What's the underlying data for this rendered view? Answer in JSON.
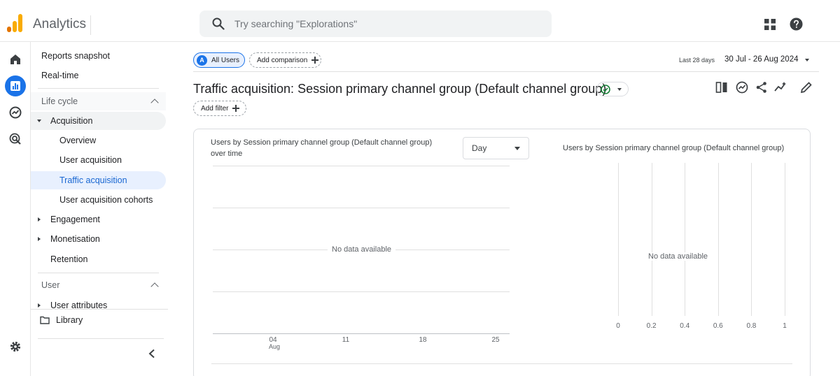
{
  "app": {
    "title": "Analytics"
  },
  "search": {
    "placeholder": "Try searching \"Explorations\""
  },
  "sidebar": {
    "items": [
      {
        "label": "Reports snapshot"
      },
      {
        "label": "Real-time"
      }
    ],
    "lifecycle": {
      "heading": "Life cycle",
      "acquisition": {
        "label": "Acquisition",
        "children": [
          "Overview",
          "User acquisition",
          "Traffic acquisition",
          "User acquisition cohorts"
        ],
        "selected": "Traffic acquisition"
      },
      "engagement": "Engagement",
      "monetisation": "Monetisation",
      "retention": "Retention"
    },
    "user": {
      "heading": "User",
      "user_attributes": "User attributes"
    },
    "library": "Library"
  },
  "toolbar": {
    "segment_badge": "A",
    "segment_label": "All Users",
    "add_comparison": "Add comparison",
    "add_filter": "Add filter",
    "date_label": "Last 28 days",
    "date_range": "30 Jul - 26 Aug 2024"
  },
  "page": {
    "title": "Traffic acquisition: Session primary channel group (Default channel group)"
  },
  "card": {
    "line_chart_title": "Users by Session primary channel group (Default channel group) over time",
    "granularity": "Day",
    "bar_chart_title": "Users by Session primary channel group (Default channel group)",
    "no_data": "No data available"
  },
  "chart_data": [
    {
      "type": "line",
      "title": "Users by Session primary channel group (Default channel group) over time",
      "x_ticks": [
        {
          "label": "04",
          "sublabel": "Aug"
        },
        {
          "label": "11"
        },
        {
          "label": "18"
        },
        {
          "label": "25"
        }
      ],
      "series": [],
      "annotation": "No data available",
      "grid": true
    },
    {
      "type": "bar",
      "title": "Users by Session primary channel group (Default channel group)",
      "x_ticks": [
        "0",
        "0.2",
        "0.4",
        "0.6",
        "0.8",
        "1"
      ],
      "xlim": [
        0,
        1
      ],
      "series": [],
      "annotation": "No data available",
      "grid": true
    }
  ],
  "colors": {
    "accent": "#1a73e8",
    "logo_orange": "#f9ab00",
    "logo_dark": "#e37400",
    "success": "#188038"
  },
  "icons": [
    "search-icon",
    "apps-icon",
    "help-icon",
    "home-icon",
    "reports-icon",
    "explore-icon",
    "advertising-icon",
    "settings-icon",
    "folder-icon",
    "compare-icon",
    "insights-icon",
    "share-icon",
    "trend-icon",
    "edit-icon",
    "check-circle-icon"
  ]
}
